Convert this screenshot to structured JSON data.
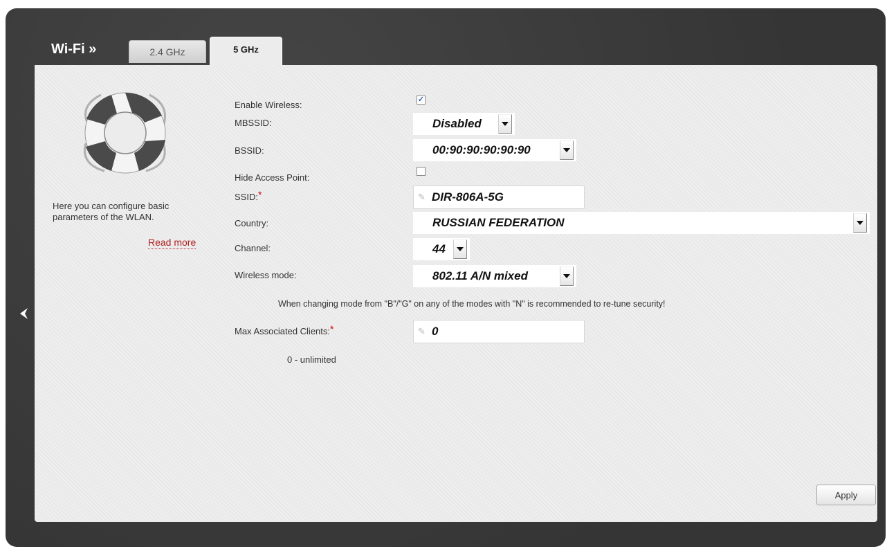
{
  "header": {
    "section_title": "Wi-Fi »",
    "tabs": [
      {
        "label": "2.4 GHz",
        "active": false
      },
      {
        "label": "5 GHz",
        "active": true
      }
    ]
  },
  "sidebar": {
    "help_text": "Here you can configure basic parameters of the WLAN.",
    "read_more": "Read more",
    "icon": "lifebuoy-icon"
  },
  "form": {
    "enable_wireless": {
      "label": "Enable Wireless:",
      "checked": true
    },
    "mbssid": {
      "label": "MBSSID:",
      "value": "Disabled"
    },
    "bssid": {
      "label": "BSSID:",
      "value": "00:90:90:90:90:90"
    },
    "hide_access_point": {
      "label": "Hide Access Point:",
      "checked": false
    },
    "ssid": {
      "label": "SSID:",
      "required": "*",
      "value": "DIR-806A-5G"
    },
    "country": {
      "label": "Country:",
      "value": "RUSSIAN FEDERATION"
    },
    "channel": {
      "label": "Channel:",
      "value": "44"
    },
    "wireless_mode": {
      "label": "Wireless mode:",
      "value": "802.11 A/N mixed"
    },
    "mode_note": "When changing mode from \"B\"/\"G\" on any of the modes with \"N\" is recommended to re-tune security!",
    "max_clients": {
      "label": "Max Associated Clients:",
      "required": "*",
      "value": "0"
    },
    "max_clients_hint": "0 - unlimited"
  },
  "actions": {
    "apply_label": "Apply"
  },
  "colors": {
    "frame": "#3a3a3a",
    "panel": "#ececec",
    "required": "#cc0000",
    "link": "#b01e1e"
  }
}
